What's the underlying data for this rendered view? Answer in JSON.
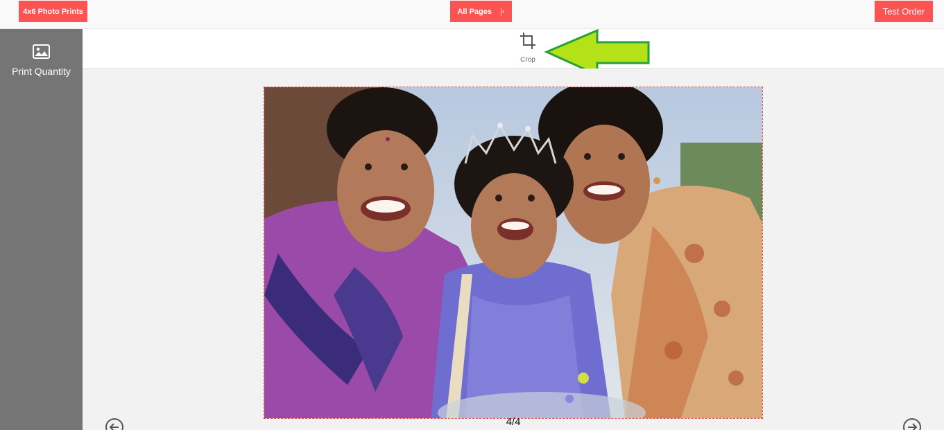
{
  "header": {
    "product_label": "4x6 Photo Prints",
    "pages_label": "All Pages",
    "pages_icon": "chevron-collapse-left-icon",
    "test_order_label": "Test Order",
    "accent_color": "#fd5353"
  },
  "sidebar": {
    "items": [
      {
        "label": "Print Quantity",
        "icon": "image-icon"
      }
    ]
  },
  "toolbar": {
    "crop_label": "Crop",
    "crop_icon": "crop-icon",
    "annotation": "green-arrow-pointer"
  },
  "editor": {
    "page_indicator": "4/4",
    "prev_icon": "arrow-left-circle-icon",
    "next_icon": "arrow-right-circle-icon",
    "photo": "family-portrait-three-smiling-women-and-girl",
    "frame_color": "#e34a4a"
  }
}
